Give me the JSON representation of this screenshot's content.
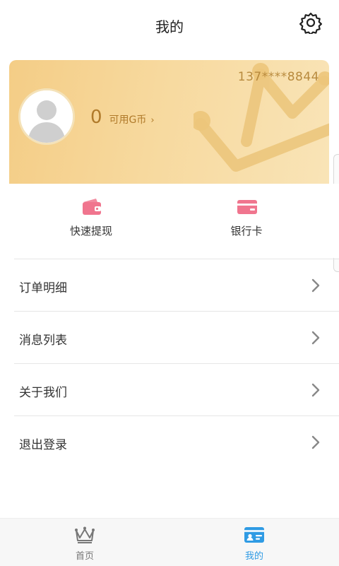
{
  "header": {
    "title": "我的"
  },
  "card": {
    "phone": "137****8844",
    "balance_value": "0",
    "balance_label": "可用G币",
    "chevron": "›"
  },
  "quick_actions": [
    {
      "label": "快速提现",
      "icon": "wallet-icon"
    },
    {
      "label": "银行卡",
      "icon": "bank-card-icon"
    }
  ],
  "menu": [
    {
      "label": "订单明细"
    },
    {
      "label": "消息列表"
    },
    {
      "label": "关于我们"
    },
    {
      "label": "退出登录"
    }
  ],
  "tabbar": {
    "home": {
      "label": "首页",
      "icon": "crown-icon"
    },
    "mine": {
      "label": "我的",
      "icon": "id-card-icon"
    }
  },
  "colors": {
    "accent_blue": "#2f9be4",
    "card_gold": "#f5d18d",
    "pink": "#f0758e",
    "tab_inactive": "#777777"
  }
}
